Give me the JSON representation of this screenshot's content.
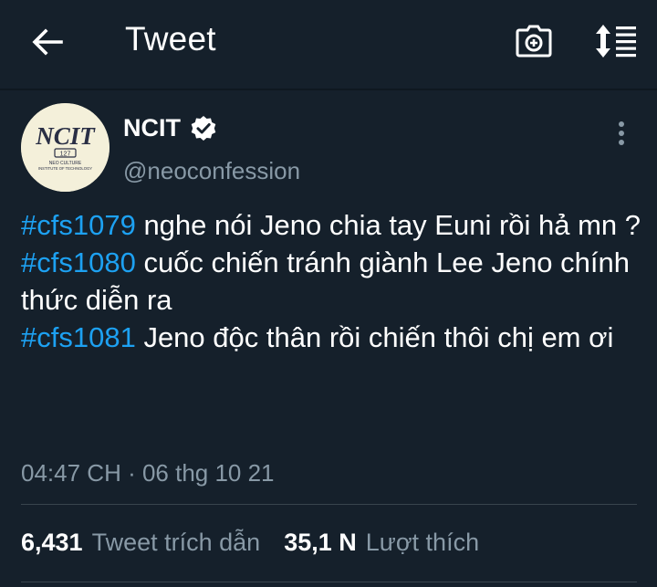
{
  "header": {
    "title": "Tweet",
    "back_icon": "arrow-left-icon",
    "camera_icon": "camera-icon",
    "sort_icon": "sort-lines-icon"
  },
  "tweet": {
    "author": {
      "name": "NCIT",
      "handle": "@neoconfession",
      "verified": true,
      "avatar_text": "NCIT",
      "avatar_badge": "127",
      "avatar_caption_1": "NEO CULTURE",
      "avatar_caption_2": "INSTITUTE OF TECHNOLOGY"
    },
    "lines": [
      {
        "hashtag": "#cfs1079",
        "text": " nghe nói Jeno chia tay Euni rồi hả mn ?"
      },
      {
        "hashtag": "#cfs1080",
        "text": " cuốc chiến tránh giành Lee Jeno chính thức diễn ra"
      },
      {
        "hashtag": "#cfs1081",
        "text": " Jeno độc thân rồi chiến thôi chị em ơi"
      }
    ],
    "timestamp": "04:47 CH · 06 thg 10 21"
  },
  "stats": {
    "quotes_count": "6,431",
    "quotes_label": "Tweet trích dẫn",
    "likes_count": "35,1 N",
    "likes_label": "Lượt thích"
  },
  "colors": {
    "background": "#15202b",
    "hashtag": "#1da1f2",
    "secondary_text": "#8899a6",
    "divider": "#38444d"
  }
}
